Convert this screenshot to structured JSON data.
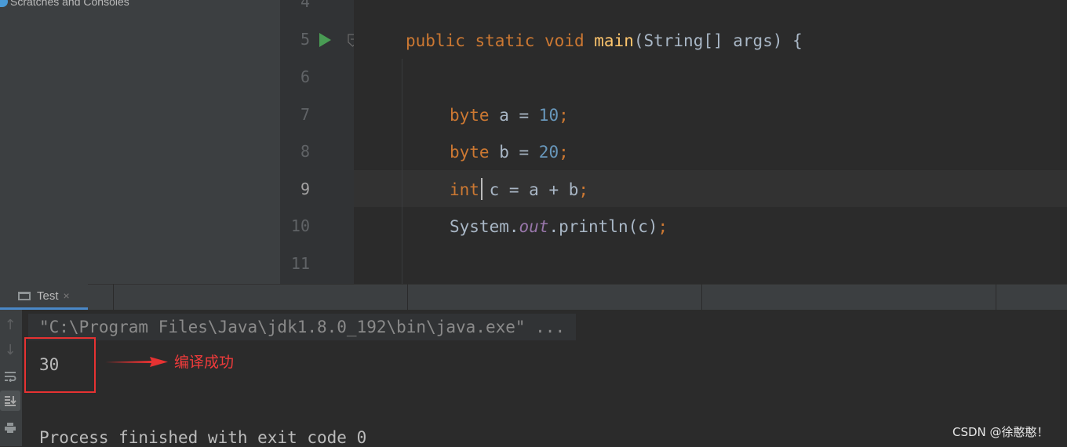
{
  "sidebar": {
    "item_label": "Scratches and Consoles"
  },
  "editor": {
    "line_numbers": [
      "4",
      "5",
      "6",
      "7",
      "8",
      "9",
      "10",
      "11"
    ],
    "current_line": "9",
    "line5": {
      "kw1": "public",
      "kw2": "static",
      "kw3": "void",
      "method": "main",
      "params": "(String[] args) {"
    },
    "line7": {
      "type": "byte",
      "rest": " a = ",
      "num": "10",
      "semi": ";"
    },
    "line8": {
      "type": "byte",
      "rest": " b = ",
      "num": "20",
      "semi": ";"
    },
    "line9": {
      "type": "int",
      "rest": " c = a + b",
      "semi": ";"
    },
    "line10": {
      "cls": "System.",
      "field": "out",
      "call": ".println(c)",
      "semi": ";"
    }
  },
  "run_panel": {
    "tab_label": "Test",
    "close_glyph": "×",
    "command_line": "\"C:\\Program Files\\Java\\jdk1.8.0_192\\bin\\java.exe\" ...",
    "output_value": "30",
    "finish_message": "Process finished with exit code 0"
  },
  "toolbar_icons": [
    "up-arrow-icon",
    "down-arrow-icon",
    "soft-wrap-icon",
    "scroll-to-end-icon",
    "print-icon"
  ],
  "annotation": {
    "text": "编译成功",
    "color": "#e63232"
  },
  "watermark": "CSDN @徐憨憨！",
  "colors": {
    "keyword": "#cc7832",
    "method": "#ffc66d",
    "number": "#6897bb",
    "field": "#9876aa",
    "text": "#a9b7c6",
    "run_icon": "#499c54"
  }
}
